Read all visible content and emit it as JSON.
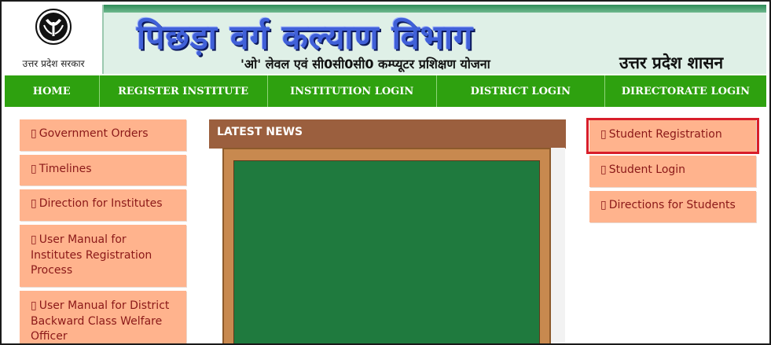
{
  "header": {
    "emblem_caption": "उत्तर प्रदेश सरकार",
    "title": "पिछड़ा वर्ग कल्याण विभाग",
    "subtitle": "'ओ' लेवल एवं सी0सी0सी0 कम्प्यूटर प्रशिक्षण योजना",
    "state": "उत्तर प्रदेश शासन"
  },
  "nav": {
    "items": [
      {
        "label": "HOME"
      },
      {
        "label": "REGISTER INSTITUTE"
      },
      {
        "label": "INSTITUTION LOGIN"
      },
      {
        "label": "DISTRICT LOGIN"
      },
      {
        "label": "DIRECTORATE LOGIN"
      }
    ]
  },
  "left_links": [
    {
      "icon": "external-link-icon",
      "glyph": "▯",
      "label": "Government Orders"
    },
    {
      "icon": "external-link-icon",
      "glyph": "▯",
      "label": "Timelines"
    },
    {
      "icon": "external-link-icon",
      "glyph": "▯",
      "label": "Direction for Institutes"
    },
    {
      "icon": "external-link-icon",
      "glyph": "▯",
      "label": "User Manual for Institutes Registration Process"
    },
    {
      "icon": "external-link-icon",
      "glyph": "▯",
      "label": "User Manual for District Backward Class Welfare Officer"
    }
  ],
  "news": {
    "title": "LATEST NEWS"
  },
  "right_links": [
    {
      "icon": "external-link-icon",
      "glyph": "▯",
      "label": "Student Registration"
    },
    {
      "icon": "external-link-icon",
      "glyph": "▯",
      "label": "Student Login"
    },
    {
      "icon": "external-link-icon",
      "glyph": "▯",
      "label": "Directions for Students"
    }
  ],
  "colors": {
    "nav_bg": "#2ea10f",
    "link_bg": "#ffb38d",
    "link_text": "#8a1818",
    "news_header_bg": "#9b5f3e",
    "board": "#1f7a3e",
    "highlight": "#d81e2a"
  }
}
